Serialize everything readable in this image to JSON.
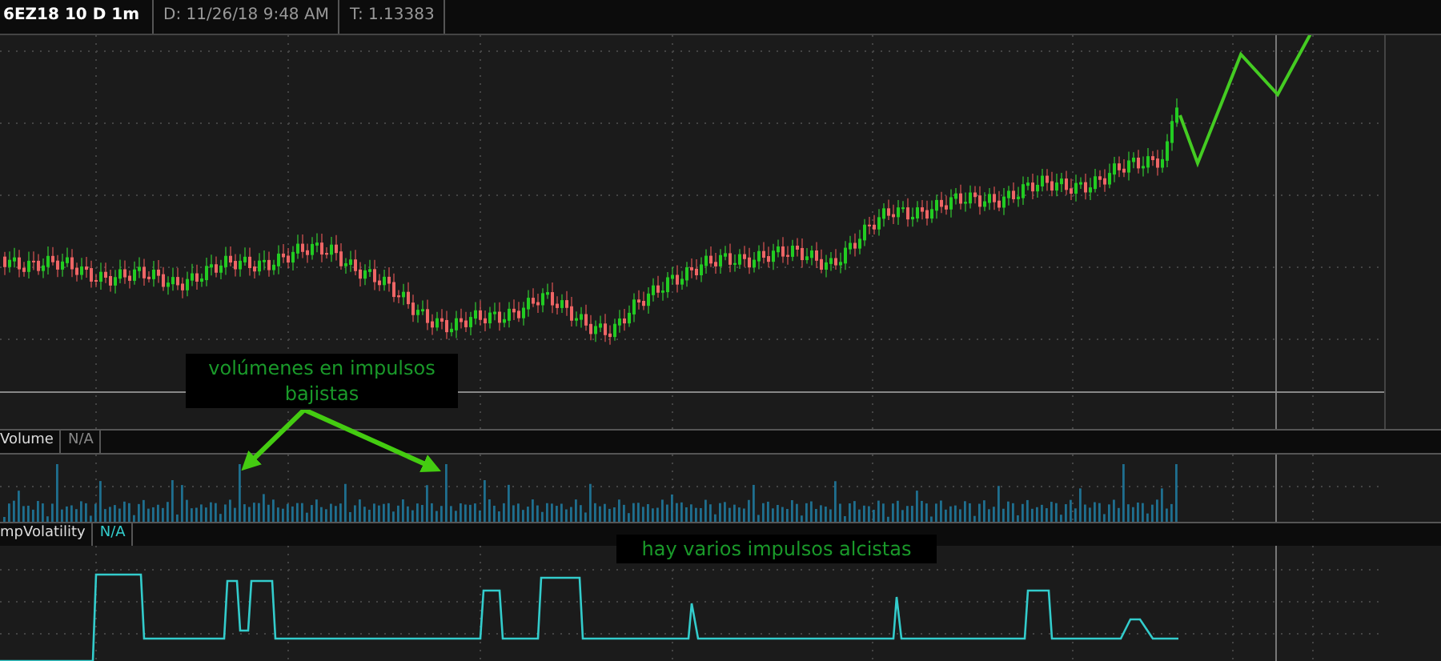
{
  "header": {
    "symbol": "6EZ18 10 D 1m",
    "date": "D: 11/26/18 9:48 AM",
    "price": "T: 1.13383"
  },
  "volume_panel": {
    "title": "Volume",
    "value": "N/A"
  },
  "volatility_panel": {
    "title": "mpVolatility",
    "value": "N/A"
  },
  "annotations": [
    {
      "kind": "volume",
      "text": "volúmenes en impulsos bajistas"
    },
    {
      "kind": "volatility",
      "text": "hay varios impulsos alcistas"
    }
  ]
}
